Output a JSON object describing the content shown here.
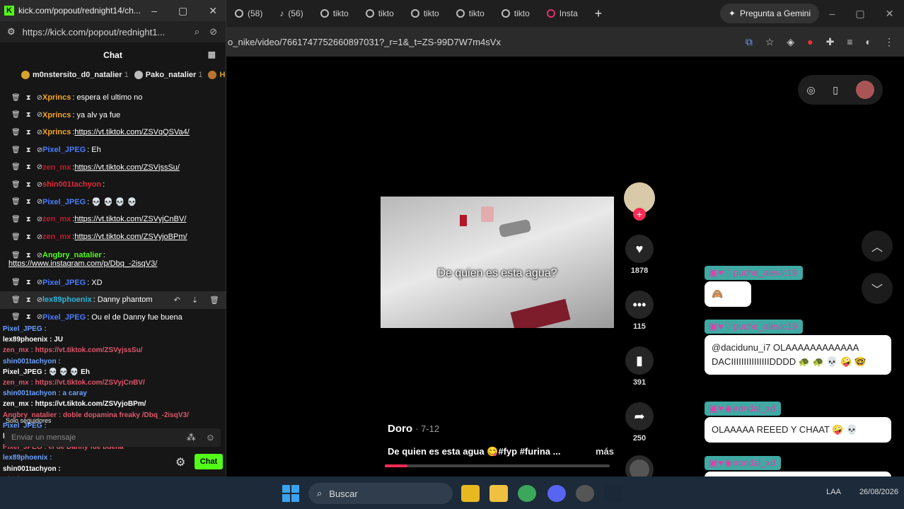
{
  "browser": {
    "tabs": [
      {
        "label": "(58)"
      },
      {
        "label": "(56)"
      },
      {
        "label": "tikto"
      },
      {
        "label": "tikto"
      },
      {
        "label": "tikto"
      },
      {
        "label": "tikto"
      },
      {
        "label": "tikto"
      },
      {
        "label": "tikto"
      },
      {
        "label": "Insta"
      }
    ],
    "gemini_label": "Pregunta a Gemini",
    "url": "o_nike/video/7661747752660897031?_r=1&_t=ZS-99D7W7m4sVx"
  },
  "tiktok": {
    "video_caption": "De quien es esta agua?",
    "likes": "1878",
    "comments": "115",
    "saves": "391",
    "shares": "250",
    "author": "Doro",
    "date": "· 7-12",
    "description": "De quien es esta agua 😋#fyp #furina ...",
    "more": "más",
    "progress": 0.1
  },
  "overlay_chat": [
    {
      "user": "puche_alevic19",
      "message": "🙈"
    },
    {
      "user": "puche_alevic19",
      "message": "@dacidunu_i7 OLAAAAAAAAAAAA DACIIIIIIIIIIIIIIIDDDD 🐢 🐢 💀 🤪 🤓"
    },
    {
      "user": "irondal_xd",
      "message": "OLAAAAA REEED Y CHAAT 🤪 💀"
    },
    {
      "user": "irondal_xd",
      "message": "ahora si estoy en mi cuarto ⬛"
    }
  ],
  "taskbar": {
    "search": "Buscar",
    "lang": "LAA",
    "date": "26/08/2026"
  },
  "kick": {
    "window_title": "kick.com/popout/rednight14/ch...",
    "url": "https://kick.com/popout/rednight1...",
    "chat_header": "Chat",
    "top_gifters": [
      {
        "name": "m0nstersito_d0_natalier",
        "count": "1"
      },
      {
        "name": "Pako_natalier",
        "count": "1"
      },
      {
        "name": "Ho",
        "count": ""
      }
    ],
    "messages": [
      {
        "user": "Xprincs",
        "color": "#f5a623",
        "text": ": espera el ultimo no",
        "link": ""
      },
      {
        "user": "Xprincs",
        "color": "#f5a623",
        "text": ": ya alv ya fue",
        "link": ""
      },
      {
        "user": "Xprincs",
        "color": "#f5a623",
        "text": ": ",
        "link": "https://vt.tiktok.com/ZSVqQSVa4/"
      },
      {
        "user": "Pixel_JPEG",
        "color": "#4a7dff",
        "text": ": Eh",
        "link": ""
      },
      {
        "user": "zen_mx",
        "color": "#c21a2c",
        "text": ": ",
        "link": "https://vt.tiktok.com/ZSVjssSu/"
      },
      {
        "user": "shin001tachyon",
        "color": "#e02a3a",
        "text": ": ",
        "link": ""
      },
      {
        "user": "Pixel_JPEG",
        "color": "#4a7dff",
        "text": ": 💀 💀 💀 💀",
        "link": ""
      },
      {
        "user": "zen_mx",
        "color": "#c21a2c",
        "text": ": ",
        "link": "https://vt.tiktok.com/ZSVyjCnBV/"
      },
      {
        "user": "zen_mx",
        "color": "#c21a2c",
        "text": ": ",
        "link": "https://vt.tiktok.com/ZSVyjoBPm/"
      },
      {
        "user": "Angbry_natalier",
        "color": "#53fc18",
        "text": ":",
        "link": "https://www.instagram.com/p/Dbq_-2isqV3/"
      },
      {
        "user": "Pixel_JPEG",
        "color": "#4a7dff",
        "text": ": XD",
        "link": ""
      },
      {
        "user": "lex89phoenix",
        "color": "#2bb3d9",
        "text": ": Danny phantom",
        "link": ""
      },
      {
        "user": "Pixel_JPEG",
        "color": "#4a7dff",
        "text": ": Ou el de Danny fue buena",
        "link": ""
      }
    ],
    "overlay_lines": [
      {
        "text": "Pixel_JPEG :"
      },
      {
        "text": "lex89phoenix : JU"
      },
      {
        "text": "zen_mx : https://vt.tiktok.com/ZSVyjssSu/"
      },
      {
        "text": "shin001tachyon :"
      },
      {
        "text": "Pixel_JPEG : 💀 💀 💀 Eh"
      },
      {
        "text": "zen_mx : https://vt.tiktok.com/ZSVyjCnBV/"
      },
      {
        "text": "shin001tachyon : a caray"
      },
      {
        "text": "zen_mx : https://vt.tiktok.com/ZSVyjoBPm/"
      },
      {
        "text": "Angbry_natalier : doble dopamina freaky  /Dbq_-2isqV3/"
      },
      {
        "text": "Pixel_JPEG :"
      },
      {
        "text": "lex89phoenix : Danny phantom"
      },
      {
        "text": "Pixel_JPEG : el de Danny fue buena"
      },
      {
        "text": "lex89phoenix :"
      },
      {
        "text": "shin001tachyon :"
      },
      {
        "text": "Pixel_JPEG :"
      },
      {
        "text": "shin001tachyon : a caray"
      },
      {
        "text": "Clipe_A : doble dopamina freaky"
      }
    ],
    "followers_only": "Solo seguidores",
    "input_placeholder": "Enviar un mensaje",
    "chat_button": "Chat"
  }
}
